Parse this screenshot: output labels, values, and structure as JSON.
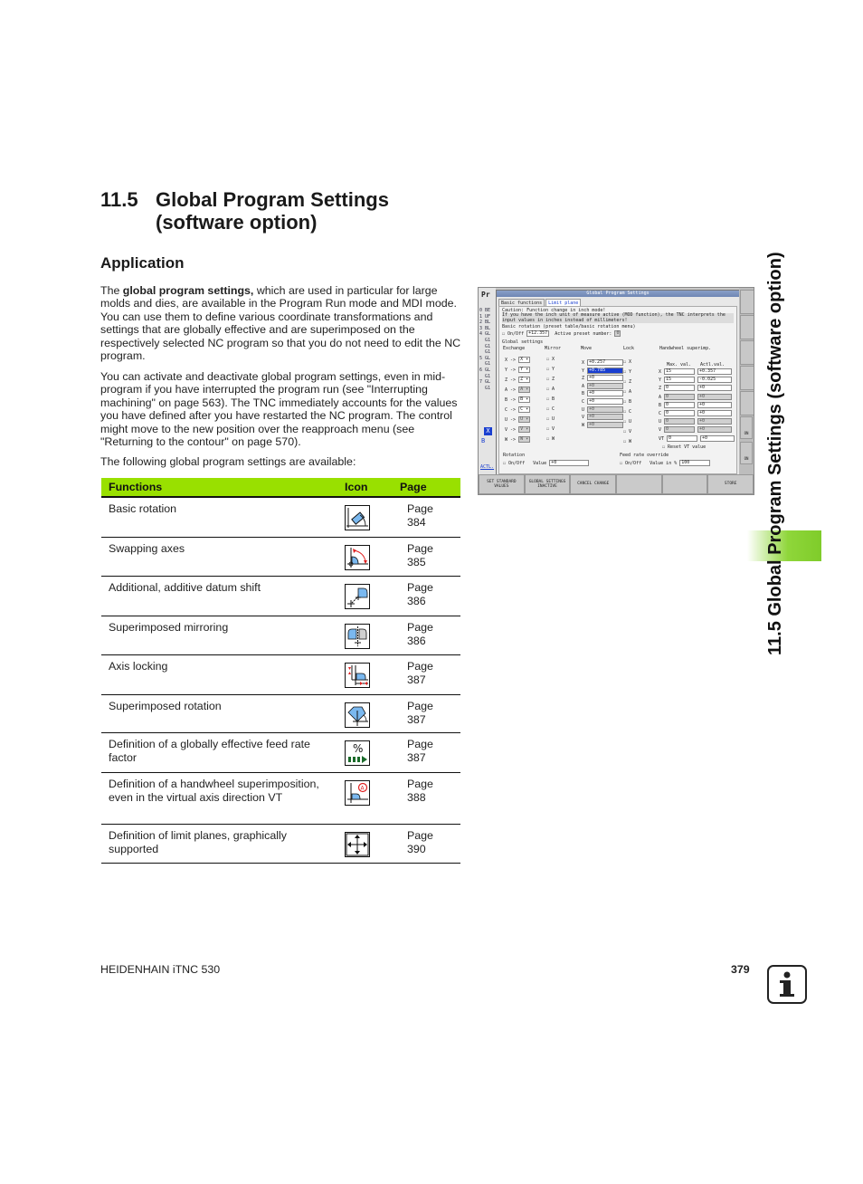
{
  "section": {
    "number": "11.5",
    "title": "Global Program Settings (software option)",
    "subheading": "Application"
  },
  "paragraphs": {
    "p1_intro": "The ",
    "p1_bold": "global program settings,",
    "p1_rest": " which are used in particular for large molds and dies, are available in the Program Run mode and MDI mode. You can use them to define various coordinate transformations and settings that are globally effective and are superimposed on the respectively selected NC program so that you do not need to edit the NC program.",
    "p2": "You can activate and deactivate global program settings, even in mid-program if you have interrupted the program run (see \"Interrupting machining\" on page 563). The TNC immediately accounts for the values you have defined after you have restarted the NC program. The control might move to the new position over the reapproach menu (see \"Returning to the contour\" on page 570).",
    "p3": "The following global program settings are available:"
  },
  "table": {
    "headers": {
      "functions": "Functions",
      "icon": "Icon",
      "page": "Page"
    },
    "header_color": "#99e000",
    "rows": [
      {
        "function": "Basic rotation",
        "icon": "basic-rotation-icon",
        "page": "Page 384"
      },
      {
        "function": "Swapping axes",
        "icon": "swap-axes-icon",
        "page": "Page 385"
      },
      {
        "function": "Additional, additive datum shift",
        "icon": "datum-shift-icon",
        "page": "Page 386"
      },
      {
        "function": "Superimposed mirroring",
        "icon": "mirroring-icon",
        "page": "Page 386"
      },
      {
        "function": "Axis locking",
        "icon": "axis-lock-icon",
        "page": "Page 387"
      },
      {
        "function": "Superimposed rotation",
        "icon": "rotation-icon",
        "page": "Page 387"
      },
      {
        "function": "Definition of a globally effective feed rate factor",
        "icon": "feed-rate-icon",
        "page": "Page 387"
      },
      {
        "function": "Definition of a handwheel superimposition, even in the virtual axis direction VT",
        "icon": "handwheel-icon",
        "page": "Page 388"
      },
      {
        "function": "Definition of limit planes, graphically supported",
        "icon": "limit-planes-icon",
        "page": "Page 390"
      }
    ]
  },
  "screenshot": {
    "mode_label": "Pr",
    "window_title": "Global Program Settings",
    "tabs": [
      "Basic functions",
      "Limit plane"
    ],
    "caution": "Caution: Function change in inch mode!",
    "message": "If you have the inch unit of measure active (MOD function), the TNC interprets the input values in inches instead of millimeters!",
    "basic_rotation_label": "Basic rotation (preset table/basic rotation menu)",
    "onoff": "On/Off",
    "basic_rotation_value": "+12.357",
    "active_preset_label": "Active preset number:",
    "active_preset_value": "0",
    "global_settings_label": "Global settings",
    "groups": {
      "exchange": "Exchange",
      "mirror": "Mirror",
      "move": "Move",
      "lock": "Lock",
      "handwheel": "Handwheel superimp."
    },
    "exchange_rows": [
      "X -> X",
      "Y -> Y",
      "Z -> Z",
      "A -> A",
      "B -> B",
      "C -> C",
      "U -> U",
      "V -> V",
      "W -> W"
    ],
    "mirror_axes": [
      "X",
      "Y",
      "Z",
      "A",
      "B",
      "C",
      "U",
      "V",
      "W"
    ],
    "move_values": [
      {
        "axis": "X",
        "value": "+0.257"
      },
      {
        "axis": "Y",
        "value": "+0.785",
        "selected": true
      },
      {
        "axis": "Z",
        "value": "+0"
      },
      {
        "axis": "A",
        "value": "+0"
      },
      {
        "axis": "B",
        "value": "+0"
      },
      {
        "axis": "C",
        "value": "+0"
      },
      {
        "axis": "U",
        "value": "+0"
      },
      {
        "axis": "V",
        "value": "+0"
      },
      {
        "axis": "W",
        "value": "+0"
      }
    ],
    "handwheel_headers": {
      "max": "Max. val.",
      "actl": "Actl.val."
    },
    "handwheel_rows": [
      {
        "axis": "X",
        "max": "15",
        "actl": "+0.357"
      },
      {
        "axis": "Y",
        "max": "15",
        "actl": "-0.025"
      },
      {
        "axis": "Z",
        "max": "0",
        "actl": "+0"
      },
      {
        "axis": "A",
        "max": "0",
        "actl": "+0"
      },
      {
        "axis": "B",
        "max": "0",
        "actl": "+0"
      },
      {
        "axis": "C",
        "max": "0",
        "actl": "+0"
      },
      {
        "axis": "U",
        "max": "0",
        "actl": "+0"
      },
      {
        "axis": "V",
        "max": "0",
        "actl": "+0"
      },
      {
        "axis": "VT",
        "max": "0",
        "actl": "+0"
      }
    ],
    "reset_vt": "Reset VT value",
    "rotation_label": "Rotation",
    "rotation_value_label": "Value",
    "rotation_value": "+0",
    "feed_override_label": "Feed rate override",
    "feed_value_label": "Value in %",
    "feed_value": "100",
    "actl_label": "ACTL.",
    "axis_x": "X",
    "axis_b": "B",
    "right_on_1": "ON",
    "right_on_2": "ON",
    "softkeys": [
      "SET STANDARD VALUES",
      "GLOBAL SETTINGS INACTIVE",
      "CANCEL CHANGE",
      "",
      "",
      "STORE"
    ]
  },
  "side_tab": "11.5 Global Program Settings (software option)",
  "footer": {
    "product": "HEIDENHAIN iTNC 530",
    "page": "379"
  }
}
